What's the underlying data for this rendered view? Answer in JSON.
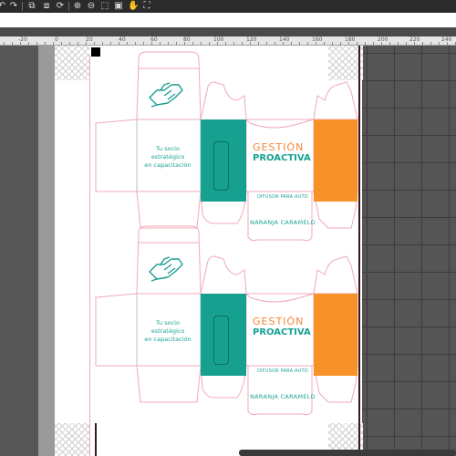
{
  "toolbar": {
    "icons": [
      "undo-icon",
      "redo-icon",
      "group-icon",
      "ungroup-icon",
      "rotate-icon",
      "zoom-in-icon",
      "zoom-out-icon",
      "zoom-selection-icon",
      "zoom-page-icon",
      "hand-icon",
      "fit-icon"
    ]
  },
  "ruler": {
    "labels": [
      "-20",
      "0",
      "20",
      "40",
      "60",
      "80",
      "100",
      "120",
      "140",
      "160",
      "180",
      "200",
      "220",
      "240"
    ]
  },
  "box1": {
    "tagline": [
      "Tu socio",
      "estratégico",
      "en capacitación"
    ],
    "brand_line1": "GESTIÓN",
    "brand_line2": "PROACTIVA",
    "product": "DIFUSOR PARA AUTO",
    "scent": "NARANJA CARAMELO"
  },
  "box2": {
    "tagline": [
      "Tu socio",
      "estratégico",
      "en capacitación"
    ],
    "brand_line1": "GESTIÓN",
    "brand_line2": "PROACTIVA",
    "product": "DIFUSOR PARA AUTO",
    "scent": "NARANJA CARAMELO"
  },
  "colors": {
    "teal": "#16a08f",
    "orange": "#f79228",
    "dieline": "#f0a8b8",
    "pasteboard": "#5f5f5f"
  }
}
